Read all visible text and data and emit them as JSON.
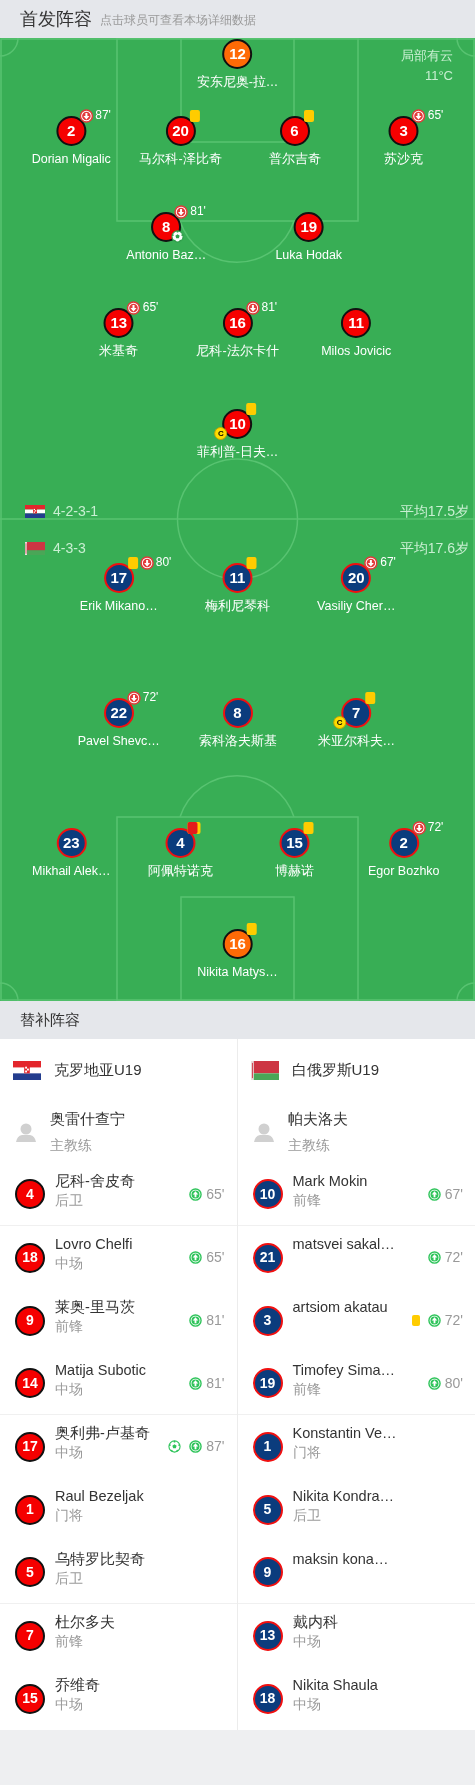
{
  "header": {
    "title": "首发阵容",
    "subtitle": "点击球员可查看本场详细数据"
  },
  "weather": {
    "condition": "局部有云",
    "temperature": "11°C"
  },
  "home": {
    "flag": {
      "kind": "croatia"
    },
    "formation": "4-2-3-1",
    "average_age": "平均17.5岁",
    "lines": [
      {
        "players": [
          {
            "number": "12",
            "name": "安东尼奥-拉…",
            "goalkeeper": true,
            "yellow_card": false,
            "red_card": false,
            "goal": false
          }
        ]
      },
      {
        "players": [
          {
            "number": "2",
            "name": "Dorian Migalic",
            "goalkeeper": false,
            "yellow_card": false,
            "red_card": false,
            "goal": false,
            "sub_out": "87'"
          },
          {
            "number": "20",
            "name": "马尔科-泽比奇",
            "goalkeeper": false,
            "yellow_card": true,
            "red_card": false,
            "goal": false
          },
          {
            "number": "6",
            "name": "普尔吉奇",
            "goalkeeper": false,
            "yellow_card": true,
            "red_card": false,
            "goal": false
          },
          {
            "number": "3",
            "name": "苏沙克",
            "goalkeeper": false,
            "yellow_card": false,
            "red_card": false,
            "goal": false,
            "sub_out": "65'"
          }
        ]
      },
      {
        "players": [
          {
            "number": "8",
            "name": "Antonio Baz…",
            "goalkeeper": false,
            "yellow_card": false,
            "red_card": false,
            "goal": true,
            "sub_out": "81'"
          },
          {
            "number": "19",
            "name": "Luka Hodak",
            "goalkeeper": false,
            "yellow_card": false,
            "red_card": false,
            "goal": false
          }
        ]
      },
      {
        "players": [
          {
            "number": "13",
            "name": "米基奇",
            "goalkeeper": false,
            "yellow_card": false,
            "red_card": false,
            "goal": false,
            "sub_out": "65'"
          },
          {
            "number": "16",
            "name": "尼科-法尔卡什",
            "goalkeeper": false,
            "yellow_card": false,
            "red_card": false,
            "goal": false,
            "sub_out": "81'"
          },
          {
            "number": "11",
            "name": "Milos Jovicic",
            "goalkeeper": false,
            "yellow_card": false,
            "red_card": false,
            "goal": false
          }
        ]
      },
      {
        "players": [
          {
            "number": "10",
            "name": "菲利普-日夫…",
            "goalkeeper": false,
            "yellow_card": true,
            "red_card": false,
            "goal": false,
            "captain_badge": "C"
          }
        ]
      }
    ]
  },
  "away": {
    "flag": {
      "kind": "belarus"
    },
    "formation": "4-3-3",
    "average_age": "平均17.6岁",
    "lines": [
      {
        "players": [
          {
            "number": "17",
            "name": "Erik Mikano…",
            "goalkeeper": false,
            "yellow_card": true,
            "red_card": false,
            "goal": false,
            "sub_out": "80'"
          },
          {
            "number": "11",
            "name": "梅利尼琴科",
            "goalkeeper": false,
            "yellow_card": true,
            "red_card": false,
            "goal": false
          },
          {
            "number": "20",
            "name": "Vasiliy Cher…",
            "goalkeeper": false,
            "yellow_card": false,
            "red_card": false,
            "goal": false,
            "sub_out": "67'"
          }
        ]
      },
      {
        "players": [
          {
            "number": "22",
            "name": "Pavel Shevc…",
            "goalkeeper": false,
            "yellow_card": false,
            "red_card": false,
            "goal": false,
            "sub_out": "72'"
          },
          {
            "number": "8",
            "name": "索科洛夫斯基",
            "goalkeeper": false,
            "yellow_card": false,
            "red_card": false,
            "goal": false
          },
          {
            "number": "7",
            "name": "米亚尔科夫…",
            "goalkeeper": false,
            "yellow_card": true,
            "red_card": false,
            "goal": false,
            "captain_badge": "C"
          }
        ]
      },
      {
        "players": [
          {
            "number": "23",
            "name": "Mikhail Alek…",
            "goalkeeper": false,
            "yellow_card": false,
            "red_card": false,
            "goal": false
          },
          {
            "number": "4",
            "name": "阿佩特诺克",
            "goalkeeper": false,
            "yellow_card": false,
            "red_card": true,
            "goal": false
          },
          {
            "number": "15",
            "name": "博赫诺",
            "goalkeeper": false,
            "yellow_card": true,
            "red_card": false,
            "goal": false
          },
          {
            "number": "2",
            "name": "Egor Bozhko",
            "goalkeeper": false,
            "yellow_card": false,
            "red_card": false,
            "goal": false,
            "sub_out": "72'"
          }
        ]
      },
      {
        "players": [
          {
            "number": "16",
            "name": "Nikita Matys…",
            "goalkeeper": true,
            "yellow_card": true,
            "red_card": false,
            "goal": false
          }
        ]
      }
    ]
  },
  "substitutes": {
    "title": "替补阵容",
    "teams": [
      {
        "name": "克罗地亚U19",
        "flag": {
          "kind": "croatia"
        },
        "kind": "home",
        "coach": {
          "name": "奥雷什查宁",
          "role": "主教练"
        },
        "players": [
          {
            "number": "4",
            "name": "尼科-舍皮奇",
            "position": "后卫",
            "sub_in": "65'",
            "yellow_card": false,
            "goal": false
          },
          {
            "number": "18",
            "name": "Lovro Chelfi",
            "position": "中场",
            "sub_in": "65'",
            "yellow_card": false,
            "goal": false
          },
          {
            "number": "9",
            "name": "莱奥-里马茨",
            "position": "前锋",
            "sub_in": "81'",
            "yellow_card": false,
            "goal": false
          },
          {
            "number": "14",
            "name": "Matija Subotic",
            "position": "中场",
            "sub_in": "81'",
            "yellow_card": false,
            "goal": false
          },
          {
            "number": "17",
            "name": "奥利弗-卢基奇",
            "position": "中场",
            "sub_in": "87'",
            "yellow_card": false,
            "goal": true
          },
          {
            "number": "1",
            "name": "Raul Bezeljak",
            "position": "门将",
            "yellow_card": false,
            "goal": false
          },
          {
            "number": "5",
            "name": "乌特罗比契奇",
            "position": "后卫",
            "yellow_card": false,
            "goal": false
          },
          {
            "number": "7",
            "name": "杜尔多夫",
            "position": "前锋",
            "yellow_card": false,
            "goal": false
          },
          {
            "number": "15",
            "name": "乔维奇",
            "position": "中场",
            "yellow_card": false,
            "goal": false
          }
        ]
      },
      {
        "name": "白俄罗斯U19",
        "flag": {
          "kind": "belarus"
        },
        "kind": "away",
        "coach": {
          "name": "帕夫洛夫",
          "role": "主教练"
        },
        "players": [
          {
            "number": "10",
            "name": "Mark Mokin",
            "position": "前锋",
            "sub_in": "67'",
            "yellow_card": false,
            "goal": false
          },
          {
            "number": "21",
            "name": "matsvei sakal…",
            "sub_in": "72'",
            "yellow_card": false,
            "goal": false
          },
          {
            "number": "3",
            "name": "artsiom akatau",
            "sub_in": "72'",
            "yellow_card": true,
            "goal": false
          },
          {
            "number": "19",
            "name": "Timofey Sima…",
            "position": "前锋",
            "sub_in": "80'",
            "yellow_card": false,
            "goal": false
          },
          {
            "number": "1",
            "name": "Konstantin Ve…",
            "position": "门将",
            "yellow_card": false,
            "goal": false
          },
          {
            "number": "5",
            "name": "Nikita Kondra…",
            "position": "后卫",
            "yellow_card": false,
            "goal": false
          },
          {
            "number": "9",
            "name": "maksin kona…",
            "yellow_card": false,
            "goal": false
          },
          {
            "number": "13",
            "name": "戴内科",
            "position": "中场",
            "yellow_card": false,
            "goal": false
          },
          {
            "number": "18",
            "name": "Nikita Shaula",
            "position": "中场",
            "yellow_card": false,
            "goal": false
          }
        ]
      }
    ]
  }
}
